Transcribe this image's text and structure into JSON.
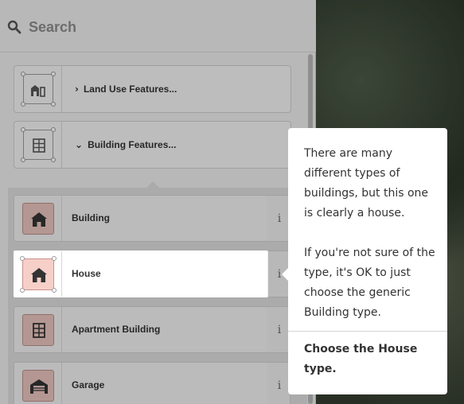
{
  "search": {
    "placeholder": "Search",
    "icon": "search-icon"
  },
  "categories": [
    {
      "label": "Land Use Features...",
      "icon": "land-use-icon",
      "expanded": false
    },
    {
      "label": "Building Features...",
      "icon": "building-grid-icon",
      "expanded": true
    }
  ],
  "presets": [
    {
      "label": "Building",
      "icon": "house-icon",
      "info": "i"
    },
    {
      "label": "House",
      "icon": "house-icon",
      "info": "i",
      "selected": true
    },
    {
      "label": "Apartment Building",
      "icon": "apartment-icon",
      "info": "i"
    },
    {
      "label": "Garage",
      "icon": "garage-icon",
      "info": "i"
    }
  ],
  "popover": {
    "paragraph1": "There are many different types of buildings, but this one is clearly a house.",
    "paragraph2": "If you're not sure of the type, it's OK to just choose the generic Building type.",
    "instruction": "Choose the House type."
  },
  "colors": {
    "preset_icon_bg": "#e7c2bd",
    "popover_bg": "#ffffff",
    "panel_bg": "#ececec"
  }
}
